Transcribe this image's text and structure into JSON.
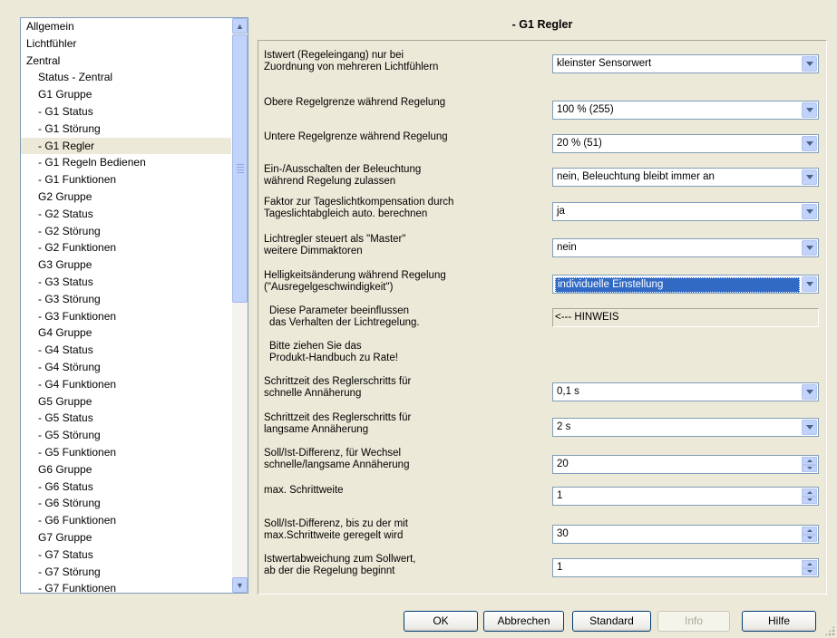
{
  "title": "- G1 Regler",
  "tree": [
    {
      "label": "Allgemein",
      "level": 0
    },
    {
      "label": "Lichtfühler",
      "level": 0
    },
    {
      "label": "Zentral",
      "level": 0
    },
    {
      "label": "Status - Zentral",
      "level": 1
    },
    {
      "label": "G1 Gruppe",
      "level": 1
    },
    {
      "label": "- G1 Status",
      "level": 1
    },
    {
      "label": "- G1 Störung",
      "level": 1
    },
    {
      "label": "- G1 Regler",
      "level": 1,
      "selected": true
    },
    {
      "label": "- G1 Regeln Bedienen",
      "level": 1
    },
    {
      "label": "- G1 Funktionen",
      "level": 1
    },
    {
      "label": "G2 Gruppe",
      "level": 1
    },
    {
      "label": "- G2 Status",
      "level": 1
    },
    {
      "label": "- G2 Störung",
      "level": 1
    },
    {
      "label": "- G2 Funktionen",
      "level": 1
    },
    {
      "label": "G3 Gruppe",
      "level": 1
    },
    {
      "label": "- G3 Status",
      "level": 1
    },
    {
      "label": "- G3 Störung",
      "level": 1
    },
    {
      "label": "- G3 Funktionen",
      "level": 1
    },
    {
      "label": "G4 Gruppe",
      "level": 1
    },
    {
      "label": "- G4 Status",
      "level": 1
    },
    {
      "label": "- G4 Störung",
      "level": 1
    },
    {
      "label": "- G4 Funktionen",
      "level": 1
    },
    {
      "label": "G5 Gruppe",
      "level": 1
    },
    {
      "label": "- G5 Status",
      "level": 1
    },
    {
      "label": "- G5 Störung",
      "level": 1
    },
    {
      "label": "- G5 Funktionen",
      "level": 1
    },
    {
      "label": "G6 Gruppe",
      "level": 1
    },
    {
      "label": "- G6 Status",
      "level": 1
    },
    {
      "label": "- G6 Störung",
      "level": 1
    },
    {
      "label": "- G6 Funktionen",
      "level": 1
    },
    {
      "label": "G7 Gruppe",
      "level": 1
    },
    {
      "label": "- G7 Status",
      "level": 1
    },
    {
      "label": "- G7 Störung",
      "level": 1
    },
    {
      "label": "- G7 Funktionen",
      "level": 1
    }
  ],
  "params": [
    {
      "label": "Istwert (Regeleingang) nur bei\nZuordnung von mehreren Lichtfühlern",
      "kind": "combo",
      "value": "kleinster Sensorwert"
    },
    {
      "label": "Obere Regelgrenze während Regelung",
      "kind": "combo",
      "value": "100 % (255)"
    },
    {
      "label": "Untere Regelgrenze während Regelung",
      "kind": "combo",
      "value": "20 %  (51)"
    },
    {
      "label": "Ein-/Ausschalten der Beleuchtung\nwährend Regelung zulassen",
      "kind": "combo",
      "value": "nein, Beleuchtung bleibt immer an"
    },
    {
      "label": "Faktor zur Tageslichtkompensation durch\nTageslichtabgleich auto. berechnen",
      "kind": "combo",
      "value": "ja"
    },
    {
      "label": "Lichtregler steuert als \"Master\"\nweitere Dimmaktoren",
      "kind": "combo",
      "value": "nein"
    },
    {
      "label": "Helligkeitsänderung während Regelung\n(\"Ausregelgeschwindigkeit\")",
      "kind": "combo",
      "value": "individuelle Einstellung",
      "focused": true
    },
    {
      "label": "Diese Parameter beeinflussen\ndas Verhalten der Lichtregelung.",
      "kind": "note",
      "value": "<--- HINWEIS",
      "indent": true
    },
    {
      "label": "Bitte ziehen Sie das\nProdukt-Handbuch zu Rate!",
      "kind": "text",
      "indent": true
    },
    {
      "label": "Schrittzeit des Reglerschritts für\nschnelle Annäherung",
      "kind": "combo",
      "value": "0,1 s"
    },
    {
      "label": "Schrittzeit des Reglerschritts für\nlangsame Annäherung",
      "kind": "combo",
      "value": "2 s"
    },
    {
      "label": "Soll/Ist-Differenz, für Wechsel\nschnelle/langsame Annäherung",
      "kind": "spin",
      "value": "20"
    },
    {
      "label": "max. Schrittweite",
      "kind": "spin",
      "value": "1"
    },
    {
      "label": "Soll/Ist-Differenz, bis zu der mit\nmax.Schrittweite geregelt wird",
      "kind": "spin",
      "value": "30"
    },
    {
      "label": "Istwertabweichung zum Sollwert,\nab der die Regelung beginnt",
      "kind": "spin",
      "value": "1"
    }
  ],
  "buttons": {
    "ok": "OK",
    "cancel": "Abbrechen",
    "default": "Standard",
    "info": "Info",
    "help": "Hilfe"
  }
}
